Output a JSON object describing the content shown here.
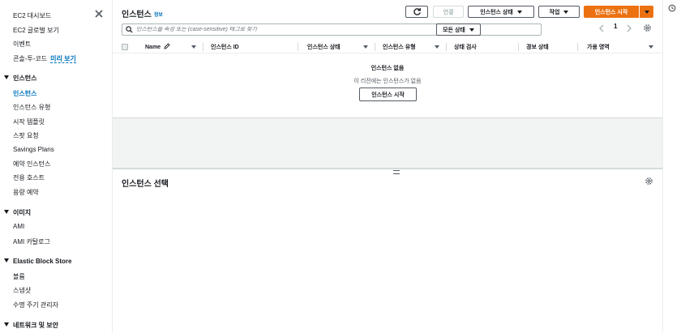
{
  "sidebar": {
    "top_links": [
      {
        "label": "EC2 대시보드"
      },
      {
        "label": "EC2 글로벌 보기"
      },
      {
        "label": "이벤트"
      }
    ],
    "console_to_code": {
      "label": "콘솔-투-코드",
      "badge": "미리 보기"
    },
    "sections": [
      {
        "header": "인스턴스",
        "items": [
          "인스턴스",
          "인스턴스 유형",
          "시작 템플릿",
          "스팟 요청",
          "Savings Plans",
          "예약 인스턴스",
          "전용 호스트",
          "용량 예약"
        ]
      },
      {
        "header": "이미지",
        "items": [
          "AMI",
          "AMI 카탈로그"
        ]
      },
      {
        "header": "Elastic Block Store",
        "items": [
          "볼륨",
          "스냅샷",
          "수명 주기 관리자"
        ]
      },
      {
        "header": "네트워크 및 보안",
        "items": []
      }
    ],
    "active_item": "인스턴스"
  },
  "header": {
    "title": "인스턴스",
    "info_link": "정보",
    "buttons": {
      "connect": "연결",
      "instance_state": "인스턴스 상태",
      "actions": "작업",
      "launch": "인스턴스 시작"
    }
  },
  "filter": {
    "search_placeholder": "인스턴스를 속성 또는 (case-sensitive) 태그로 찾기",
    "state_select": "모든 상태"
  },
  "pagination": {
    "current_page": "1"
  },
  "table": {
    "columns": [
      "Name",
      "인스턴스 ID",
      "인스턴스 상태",
      "인스턴스 유형",
      "상태 검사",
      "경보 상태",
      "가용 영역"
    ]
  },
  "empty_state": {
    "title": "인스턴스 없음",
    "message": "이 리전에는 인스턴스가 없음",
    "button": "인스턴스 시작"
  },
  "detail_panel": {
    "title": "인스턴스 선택"
  },
  "colors": {
    "accent_orange": "#ec7211",
    "link_blue": "#0073bb",
    "text": "#16191f"
  }
}
